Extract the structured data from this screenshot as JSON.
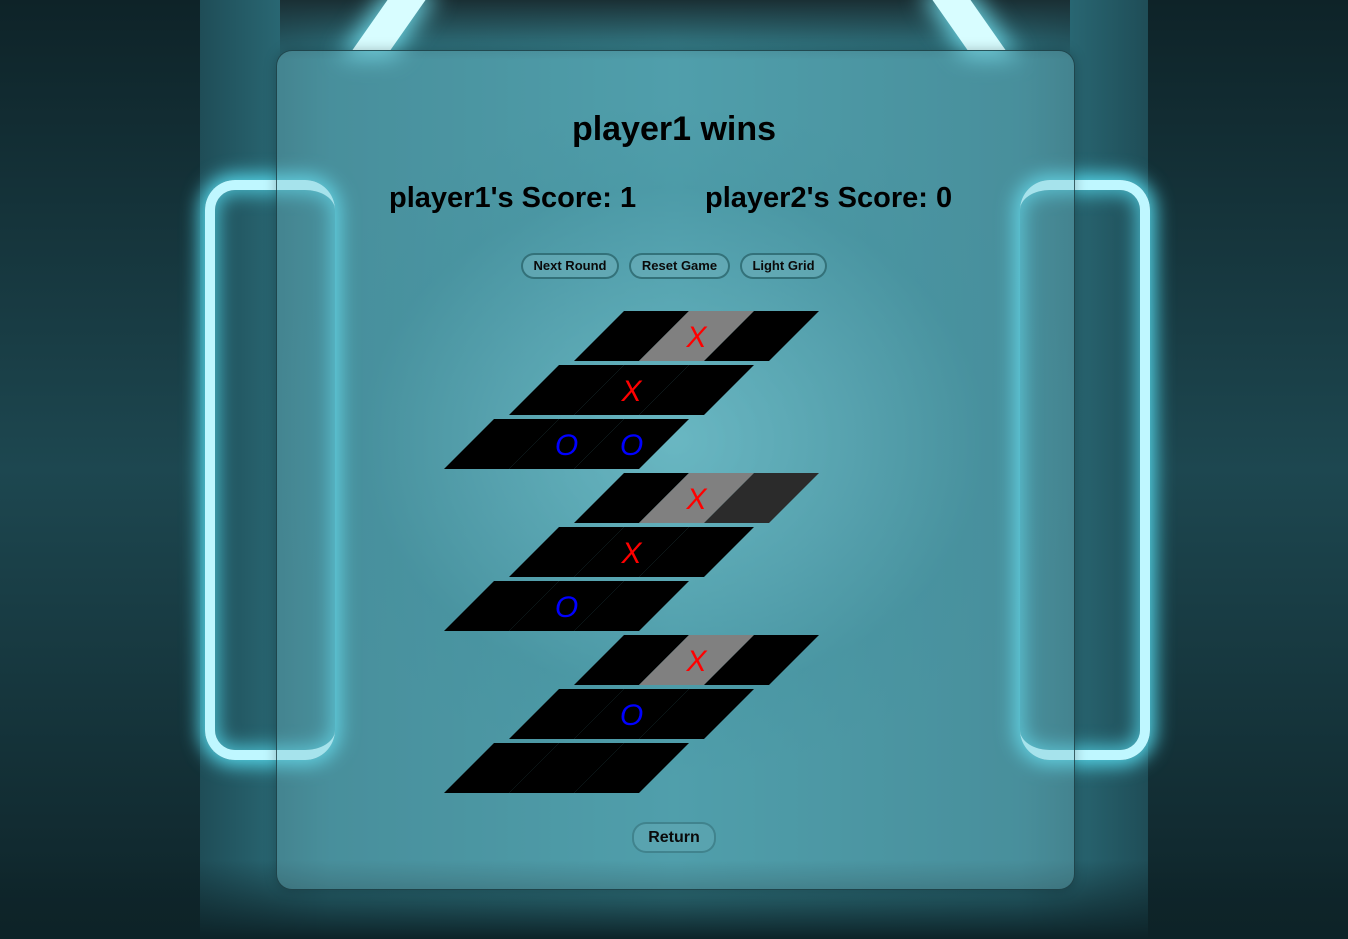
{
  "status": {
    "message": "player1 wins"
  },
  "scores": {
    "player1": "player1's Score: 1",
    "player2": "player2's Score: 0"
  },
  "buttons": {
    "next_round": "Next Round",
    "reset_game": "Reset Game",
    "light_grid": "Light Grid",
    "return": "Return"
  },
  "colors": {
    "x_mark": "#ff0000",
    "o_mark": "#0000ff",
    "cell_empty": "#000000",
    "cell_win": "#808080",
    "cell_dim": "#2b2b2b"
  },
  "boards": [
    {
      "rows": [
        [
          {
            "mark": "",
            "state": "empty"
          },
          {
            "mark": "X",
            "state": "win"
          },
          {
            "mark": "",
            "state": "empty"
          }
        ],
        [
          {
            "mark": "",
            "state": "empty"
          },
          {
            "mark": "X",
            "state": "empty"
          },
          {
            "mark": "",
            "state": "empty"
          }
        ],
        [
          {
            "mark": "",
            "state": "empty"
          },
          {
            "mark": "O",
            "state": "empty"
          },
          {
            "mark": "O",
            "state": "empty"
          }
        ]
      ]
    },
    {
      "rows": [
        [
          {
            "mark": "",
            "state": "empty"
          },
          {
            "mark": "X",
            "state": "win"
          },
          {
            "mark": "",
            "state": "dim"
          }
        ],
        [
          {
            "mark": "",
            "state": "empty"
          },
          {
            "mark": "X",
            "state": "empty"
          },
          {
            "mark": "",
            "state": "empty"
          }
        ],
        [
          {
            "mark": "",
            "state": "empty"
          },
          {
            "mark": "O",
            "state": "empty"
          },
          {
            "mark": "",
            "state": "empty"
          }
        ]
      ]
    },
    {
      "rows": [
        [
          {
            "mark": "",
            "state": "empty"
          },
          {
            "mark": "X",
            "state": "win"
          },
          {
            "mark": "",
            "state": "empty"
          }
        ],
        [
          {
            "mark": "",
            "state": "empty"
          },
          {
            "mark": "O",
            "state": "empty"
          },
          {
            "mark": "",
            "state": "empty"
          }
        ],
        [
          {
            "mark": "",
            "state": "empty"
          },
          {
            "mark": "",
            "state": "empty"
          },
          {
            "mark": "",
            "state": "empty"
          }
        ]
      ]
    }
  ]
}
